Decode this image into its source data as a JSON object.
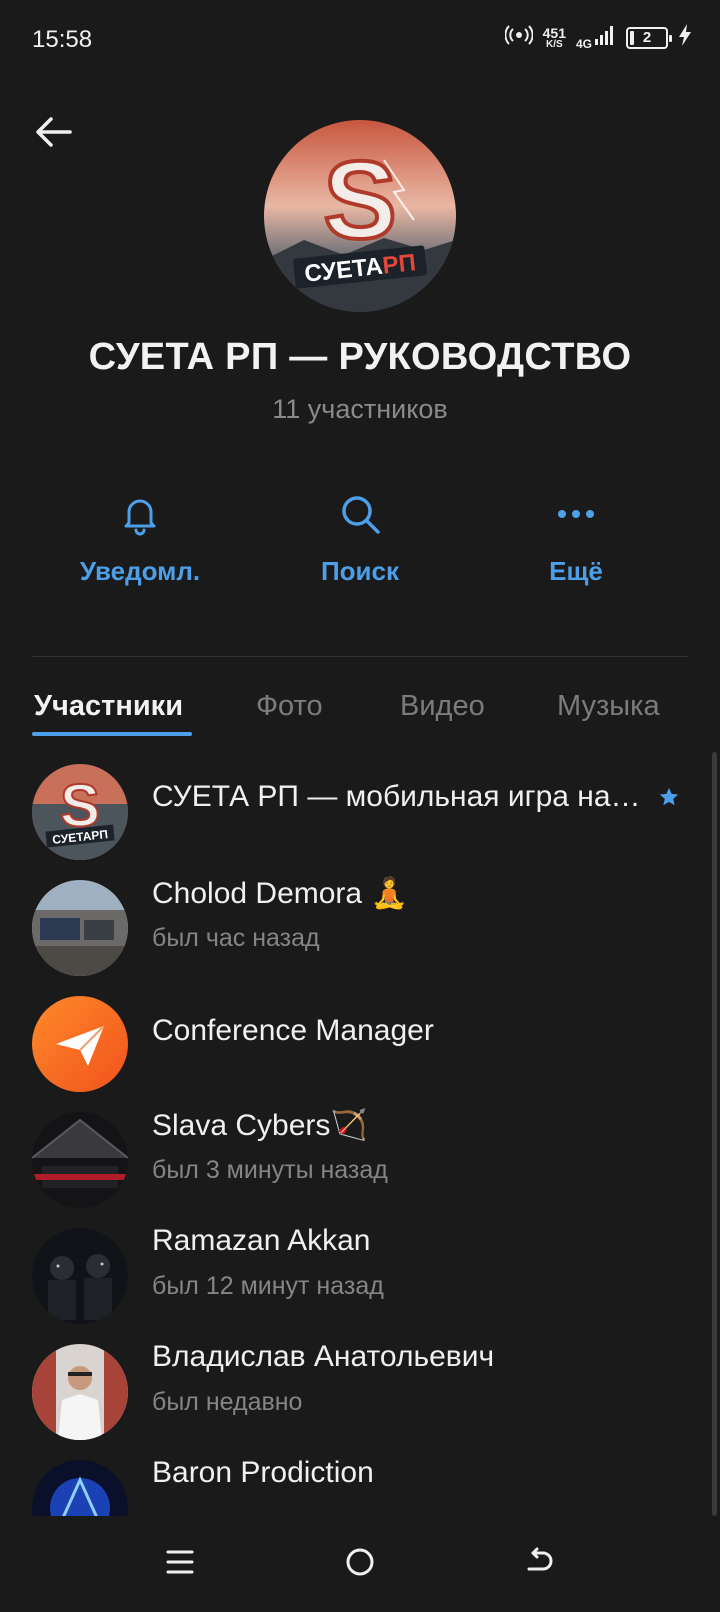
{
  "status_bar": {
    "time": "15:58",
    "net_speed_value": "451",
    "net_speed_unit": "K/S",
    "network_type": "4G",
    "battery_level": "2"
  },
  "header": {
    "back_icon": "arrow-left-icon",
    "title": "СУЕТА РП — РУКОВОДСТВО",
    "subtitle": "11 участников"
  },
  "actions": [
    {
      "label": "Уведомл.",
      "icon": "bell-icon"
    },
    {
      "label": "Поиск",
      "icon": "search-icon"
    },
    {
      "label": "Ещё",
      "icon": "more-dots-icon"
    }
  ],
  "tabs": [
    {
      "label": "Участники",
      "active": true
    },
    {
      "label": "Фото",
      "active": false
    },
    {
      "label": "Видео",
      "active": false
    },
    {
      "label": "Музыка",
      "active": false
    }
  ],
  "members": [
    {
      "name": "СУЕТА РП — мобильная игра на…",
      "status": "",
      "badge": "star-icon",
      "avatar_label": "СУЕТАРП"
    },
    {
      "name": "Cholod Demora 🧘",
      "status": "был час назад"
    },
    {
      "name": "Conference Manager",
      "status": ""
    },
    {
      "name": "Slava Cybers🏹",
      "status": "был 3 минуты назад"
    },
    {
      "name": "Ramazan Akkan",
      "status": "был 12 минут назад"
    },
    {
      "name": "Владислав Анатольевич",
      "status": "был недавно"
    },
    {
      "name": "Baron Prodiction",
      "status": ""
    }
  ],
  "colors": {
    "background": "#1a1a1a",
    "accent": "#4c9fe8",
    "text_primary": "#f0f0f0",
    "text_secondary": "#858585"
  },
  "nav_bar": {
    "icons": [
      "menu-icon",
      "home-circle-icon",
      "back-return-icon"
    ]
  }
}
